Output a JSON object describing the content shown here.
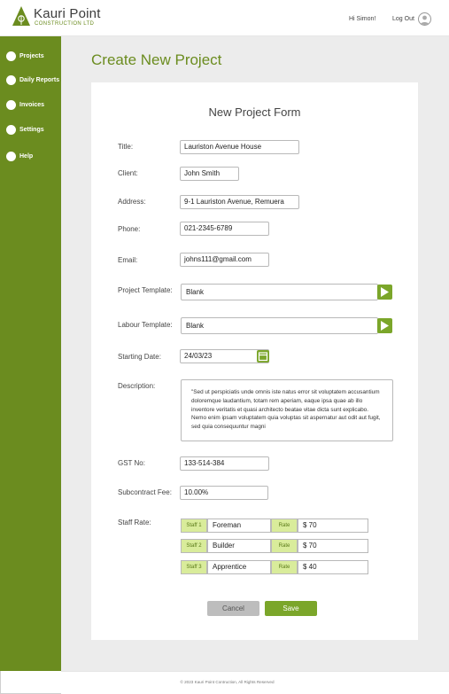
{
  "brand": {
    "name": "Kauri Point",
    "subtitle": "CONSTRUCTION LTD"
  },
  "header": {
    "greeting": "Hi Simon!",
    "logout_label": "Log Out"
  },
  "sidebar": {
    "items": [
      {
        "label": "Projects"
      },
      {
        "label": "Daily Reports"
      },
      {
        "label": "Invoices"
      },
      {
        "label": "Settings"
      },
      {
        "label": "Help"
      }
    ]
  },
  "page": {
    "title": "Create New Project"
  },
  "form": {
    "title": "New Project Form",
    "title_field": {
      "label": "Title:",
      "value": "Lauriston Avenue House"
    },
    "client": {
      "label": "Client:",
      "value": "John Smith"
    },
    "address": {
      "label": "Address:",
      "value": "9-1 Lauriston Avenue, Remuera"
    },
    "phone": {
      "label": "Phone:",
      "value": "021-2345-6789"
    },
    "email": {
      "label": "Email:",
      "value": "johns111@gmail.com"
    },
    "project_template": {
      "label": "Project Template:",
      "value": "Blank"
    },
    "labour_template": {
      "label": "Labour Template:",
      "value": "Blank"
    },
    "starting_date": {
      "label": "Starting Date:",
      "value": "24/03/23"
    },
    "description": {
      "label": "Description:",
      "value": "\"Sed ut perspiciatis unde omnis iste natus error sit voluptatem accusantium doloremque laudantium, totam rem aperiam, eaque ipsa quae ab illo inventore veritatis et quasi architecto beatae vitae dicta sunt explicabo. Nemo enim ipsam voluptatem quia voluptas sit aspernatur aut odit aut fugit, sed quia consequuntur magni"
    },
    "gst": {
      "label": "GST No:",
      "value": "133-514-384"
    },
    "subcontract_fee": {
      "label": "Subcontract Fee:",
      "value": "10.00%"
    },
    "staff_rate": {
      "label": "Staff Rate:",
      "rate_tag": "Rate",
      "rows": [
        {
          "tag": "Staff 1",
          "name": "Foreman",
          "rate": "$ 70"
        },
        {
          "tag": "Staff 2",
          "name": "Builder",
          "rate": "$ 70"
        },
        {
          "tag": "Staff 3",
          "name": "Apprentice",
          "rate": "$ 40"
        }
      ]
    },
    "cancel_label": "Cancel",
    "save_label": "Save"
  },
  "footer": {
    "text": "© 2023 Kauri Point Contruction, All Rights Reserved"
  },
  "colors": {
    "accent": "#6b8c1f",
    "button": "#7ba62a",
    "tag_bg": "#d9ec9b",
    "main_bg": "#ececec"
  }
}
